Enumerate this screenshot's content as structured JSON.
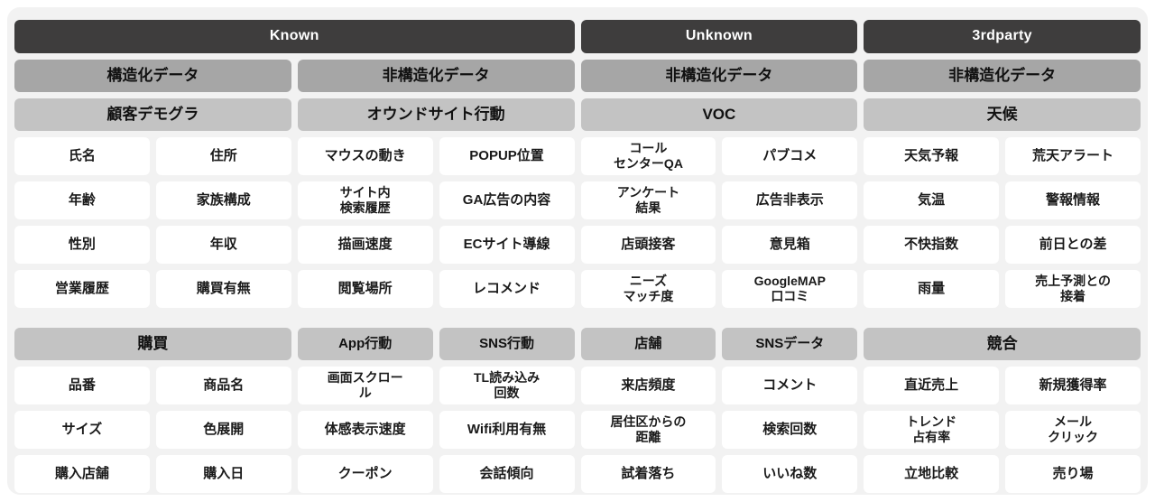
{
  "colors": {
    "page_background": "#f2f2f2",
    "group_header_bg": "#3e3d3d",
    "group_header_text": "#ffffff",
    "band_structured_bg": "#a6a6a6",
    "band_category_bg": "#c3c3c3",
    "item_bg": "#ffffff",
    "item_text": "#1a1a1a"
  },
  "groups": [
    {
      "label": "Known",
      "span": 4
    },
    {
      "label": "Unknown",
      "span": 2
    },
    {
      "label": "3rdparty",
      "span": 2
    }
  ],
  "data_types": [
    {
      "label": "構造化データ",
      "span": 2
    },
    {
      "label": "非構造化データ",
      "span": 2
    },
    {
      "label": "非構造化データ",
      "span": 2
    },
    {
      "label": "非構造化データ",
      "span": 2
    }
  ],
  "categories_top": [
    {
      "label": "顧客デモグラ",
      "span": 2
    },
    {
      "label": "オウンドサイト行動",
      "span": 2
    },
    {
      "label": "VOC",
      "span": 2
    },
    {
      "label": "天候",
      "span": 2
    }
  ],
  "items_top": [
    [
      "氏名",
      "住所",
      "マウスの動き",
      "POPUP位置",
      "コール\nセンターQA",
      "パブコメ",
      "天気予報",
      "荒天アラート"
    ],
    [
      "年齢",
      "家族構成",
      "サイト内\n検索履歴",
      "GA広告の内容",
      "アンケート\n結果",
      "広告非表示",
      "気温",
      "警報情報"
    ],
    [
      "性別",
      "年収",
      "描画速度",
      "ECサイト導線",
      "店頭接客",
      "意見箱",
      "不快指数",
      "前日との差"
    ],
    [
      "営業履歴",
      "購買有無",
      "閲覧場所",
      "レコメンド",
      "ニーズ\nマッチ度",
      "GoogleMAP\n口コミ",
      "雨量",
      "売上予測との\n接着"
    ]
  ],
  "categories_bottom": [
    {
      "label": "購買",
      "span": 2
    },
    {
      "label": "App行動",
      "span": 1
    },
    {
      "label": "SNS行動",
      "span": 1
    },
    {
      "label": "店舗",
      "span": 1
    },
    {
      "label": "SNSデータ",
      "span": 1
    },
    {
      "label": "競合",
      "span": 2
    }
  ],
  "items_bottom": [
    [
      "品番",
      "商品名",
      "画面スクロー\nル",
      "TL読み込み\n回数",
      "来店頻度",
      "コメント",
      "直近売上",
      "新規獲得率"
    ],
    [
      "サイズ",
      "色展開",
      "体感表示速度",
      "Wifi利用有無",
      "居住区からの\n距離",
      "検索回数",
      "トレンド\n占有率",
      "メール\nクリック"
    ],
    [
      "購入店舗",
      "購入日",
      "クーポン",
      "会話傾向",
      "試着落ち",
      "いいね数",
      "立地比較",
      "売り場"
    ]
  ]
}
